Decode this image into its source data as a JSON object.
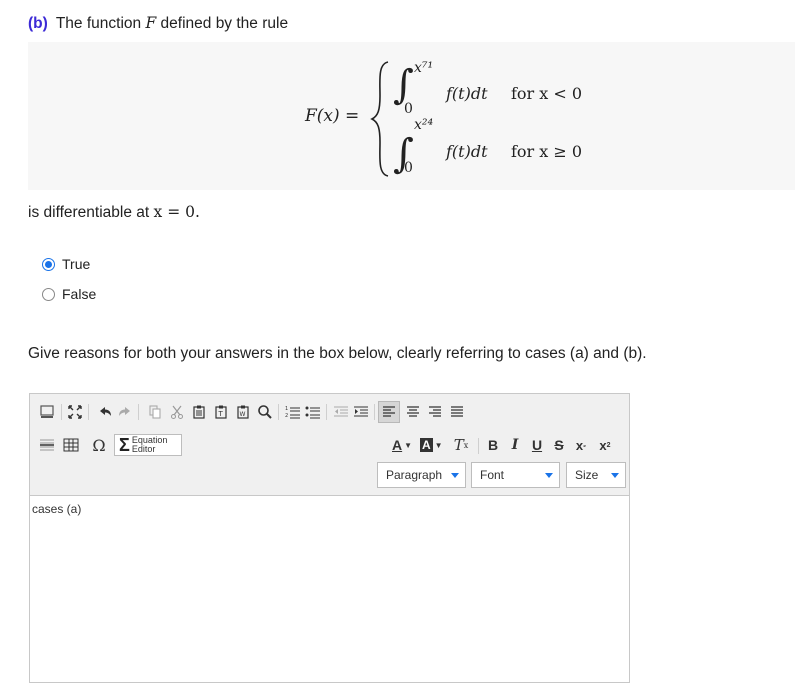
{
  "question": {
    "part_label": "(b)",
    "header_text": "The function",
    "function_name": "F",
    "header_tail": "defined by the rule",
    "formula": {
      "lhs": "F(x) =",
      "integral_symbol": "∫",
      "case1_upper": "x⁷¹",
      "case1_lower": "0",
      "case1_integrand": "f(t)dt",
      "case1_condition": "for x < 0",
      "case2_upper": "x²⁴",
      "case2_lower": "0",
      "case2_integrand": "f(t)dt",
      "case2_condition": "for x ≥ 0"
    },
    "statement_prefix": "is differentiable at",
    "statement_math": "x = 0."
  },
  "options": [
    {
      "label": "True",
      "selected": true
    },
    {
      "label": "False",
      "selected": false
    }
  ],
  "reasons_prompt": "Give reasons for both your answers in the box below, clearly referring to cases (a) and (b).",
  "editor": {
    "equation_editor_label_1": "Equation",
    "equation_editor_label_2": "Editor",
    "paragraph_label": "Paragraph",
    "font_label": "Font",
    "size_label": "Size",
    "content": "cases (a)",
    "accent_color": "#1a73e8"
  }
}
